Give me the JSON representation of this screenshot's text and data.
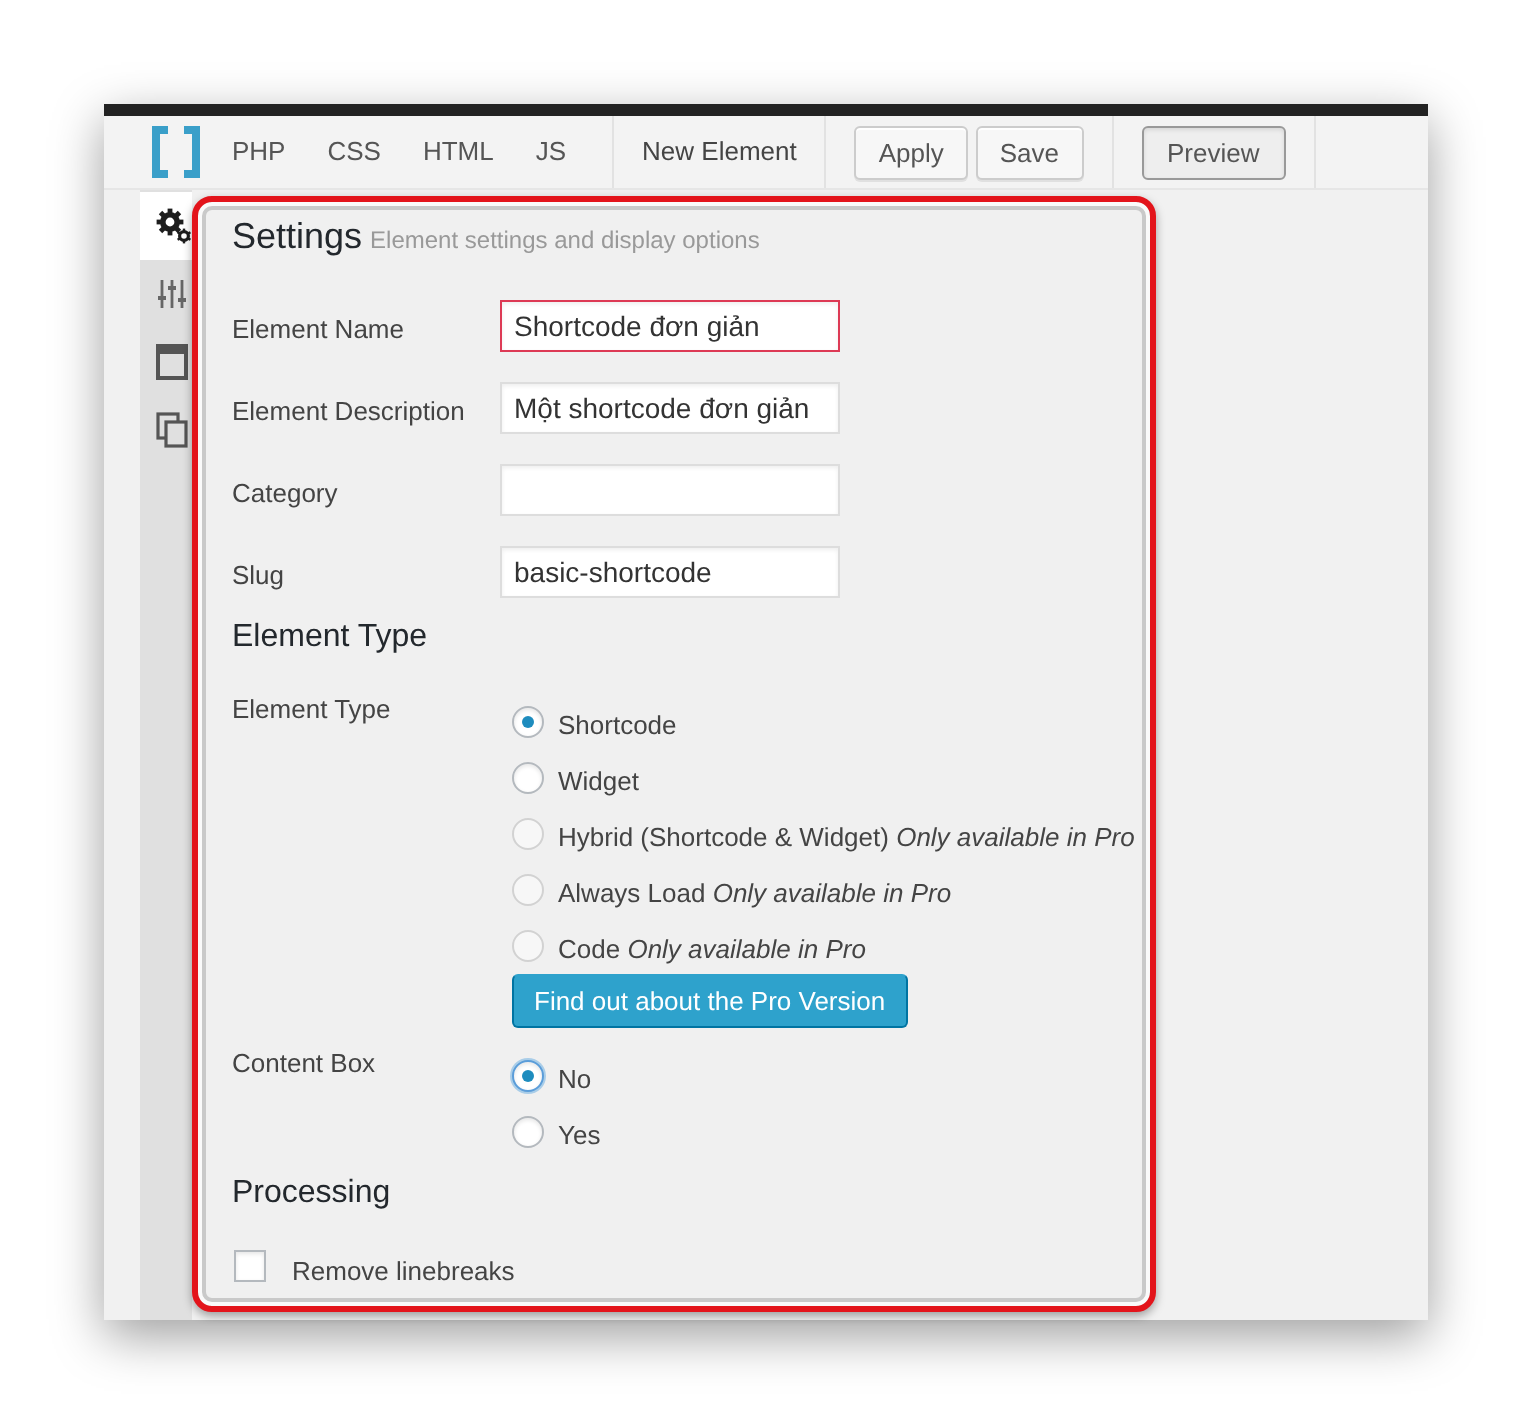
{
  "toolbar": {
    "tabs": [
      {
        "label": "PHP",
        "selected": false
      },
      {
        "label": "CSS",
        "selected": false
      },
      {
        "label": "HTML",
        "selected": false
      },
      {
        "label": "JS",
        "selected": false
      }
    ],
    "element_name": "New Element",
    "buttons": [
      {
        "label": "Apply",
        "kind": "default"
      },
      {
        "label": "Save",
        "kind": "default"
      },
      {
        "label": "Preview",
        "kind": "toggle"
      }
    ]
  },
  "sidebar": {
    "items": [
      {
        "selected": true
      },
      {
        "selected": false
      },
      {
        "selected": false
      },
      {
        "selected": false
      }
    ]
  },
  "settings": {
    "title": "Settings",
    "subtitle": "Element settings and display options",
    "fields": [
      {
        "label": "Element Name",
        "value": "Shortcode đơn giản",
        "invalid": true
      },
      {
        "label": "Element Description",
        "value": "Một shortcode đơn giản",
        "invalid": false
      },
      {
        "label": "Category",
        "invalid": false
      },
      {
        "label": "Slug",
        "value": "basic-shortcode",
        "invalid": false
      }
    ]
  },
  "element_type": {
    "heading": "Element Type",
    "groups": [
      {
        "label": "Element Type",
        "options": [
          {
            "label": "Shortcode",
            "selected": true,
            "disabled": false,
            "focused": false
          },
          {
            "label": "Widget",
            "selected": false,
            "disabled": false,
            "focused": false
          },
          {
            "label": "Hybrid (Shortcode & Widget) *Only available in Pro*",
            "selected": false,
            "disabled": true,
            "focused": false
          },
          {
            "label": "Always Load *Only available in Pro*",
            "selected": false,
            "disabled": true,
            "focused": false
          },
          {
            "label": "Code *Only available in Pro*",
            "selected": false,
            "disabled": true,
            "focused": false
          }
        ],
        "button": "Find out about the Pro Version"
      },
      {
        "label": "Content Box",
        "options": [
          {
            "label": "No",
            "selected": true,
            "disabled": false,
            "focused": true
          },
          {
            "label": "Yes",
            "selected": false,
            "disabled": false,
            "focused": false
          }
        ]
      }
    ]
  },
  "processing": {
    "heading": "Processing",
    "checkboxes": [
      {
        "label": "Remove linebreaks",
        "checked": false
      }
    ]
  }
}
